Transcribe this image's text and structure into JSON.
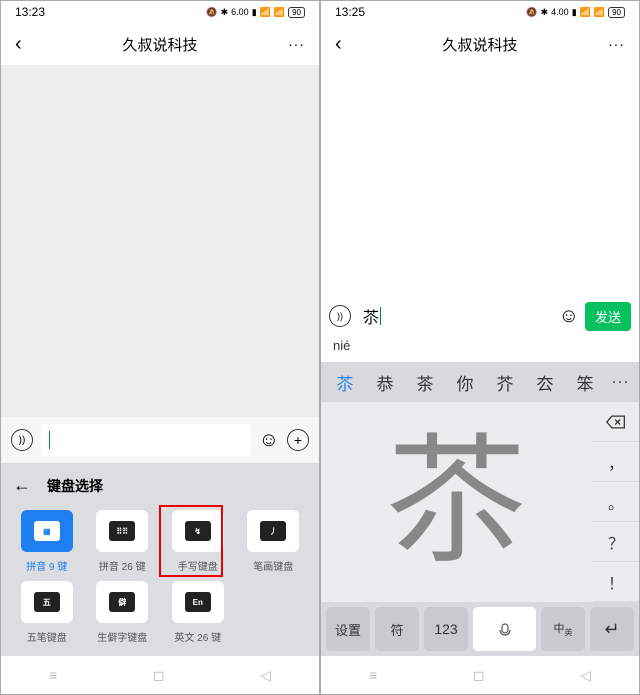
{
  "left": {
    "time": "13:23",
    "net": "6.00",
    "battery": "90",
    "title": "久叔说科技",
    "kb_panel_title": "键盘选择",
    "keyboards": [
      {
        "label": "拼音 9 键",
        "icon": "⠿",
        "active": true
      },
      {
        "label": "拼音 26 键",
        "icon": "⌨"
      },
      {
        "label": "手写键盘",
        "icon": "✎",
        "highlight": true
      },
      {
        "label": "笔画键盘",
        "icon": "丿"
      },
      {
        "label": "五笔键盘",
        "icon": "五"
      },
      {
        "label": "生僻字键盘",
        "icon": "僻"
      },
      {
        "label": "英文 26 键",
        "icon": "En"
      }
    ]
  },
  "right": {
    "time": "13:25",
    "net": "4.00",
    "battery": "90",
    "title": "久叔说科技",
    "input_char": "苶",
    "pinyin": "nié",
    "send": "发送",
    "candidates": [
      "苶",
      "恭",
      "茶",
      "你",
      "芥",
      "厺",
      "笨"
    ],
    "handwritten": "苶",
    "side_keys": [
      "⌫",
      "，",
      "。",
      "？",
      "！"
    ],
    "bottom": {
      "set": "设置",
      "sym": "符",
      "num": "123",
      "lang": "中/英",
      "enter": "↵"
    }
  }
}
